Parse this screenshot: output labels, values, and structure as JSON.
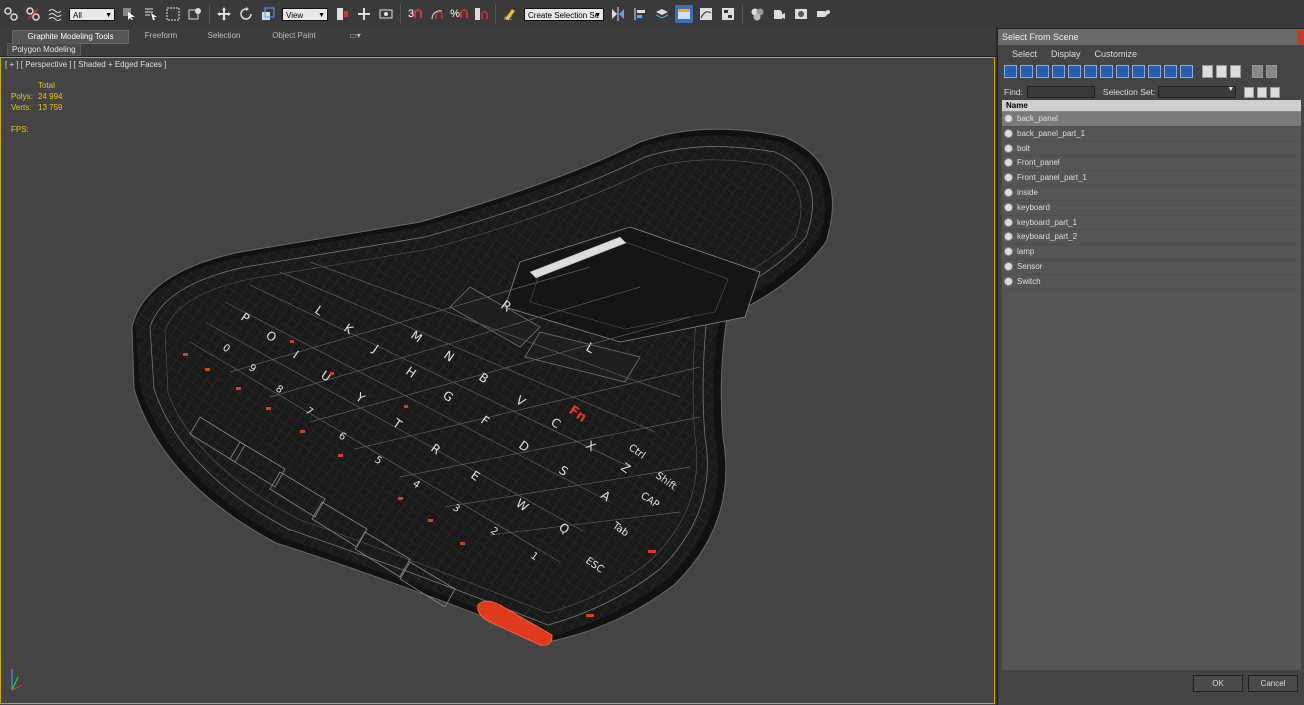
{
  "toolbar": {
    "filter_select": "All",
    "refcoord_select": "View",
    "named_selection": "Create Selection Se",
    "snap_label": "3",
    "angle_label": "",
    "percent_label": "%"
  },
  "ribbon": {
    "tabs": [
      "Graphite Modeling Tools",
      "Freeform",
      "Selection",
      "Object Paint"
    ],
    "sub_panel": "Polygon Modeling"
  },
  "viewport": {
    "label": "[ + ] [ Perspective ] [ Shaded + Edged Faces ]",
    "stats": {
      "total_header": "Total",
      "polys_label": "Polys:",
      "polys_value": "24 994",
      "verts_label": "Verts:",
      "verts_value": "13 759",
      "fps_label": "FPS:"
    },
    "keys_row1": [
      "Q",
      "W",
      "E",
      "R",
      "T",
      "Y",
      "U",
      "I",
      "O",
      "P"
    ],
    "keys_row2": [
      "A",
      "S",
      "D",
      "F",
      "G",
      "H",
      "J",
      "K",
      "L"
    ],
    "keys_row3": [
      "Z",
      "X",
      "C",
      "V",
      "B",
      "N",
      "M"
    ],
    "keys_num": [
      "1",
      "2",
      "3",
      "4",
      "5",
      "6",
      "7",
      "8",
      "9",
      "0"
    ],
    "special_keys": [
      "ESC",
      "Tab",
      "CAP",
      "Shift",
      "Ctrl",
      "Fn",
      "R",
      "L"
    ]
  },
  "panel": {
    "title": "Select From Scene",
    "menu": [
      "Select",
      "Display",
      "Customize"
    ],
    "find_label": "Find:",
    "selection_set_label": "Selection Set:",
    "column_name": "Name",
    "items": [
      "back_panel",
      "back_panel_part_1",
      "bolt",
      "Front_panel",
      "Front_panel_part_1",
      "inside",
      "keyboard",
      "keyboard_part_1",
      "keyboard_part_2",
      "lamp",
      "Sensor",
      "Switch"
    ],
    "selected_index": 0,
    "ok_label": "OK",
    "cancel_label": "Cancel"
  },
  "colors": {
    "viewport_bg": "#444444",
    "accent_yellow": "#e8c800",
    "red_key": "#e03a1e"
  }
}
